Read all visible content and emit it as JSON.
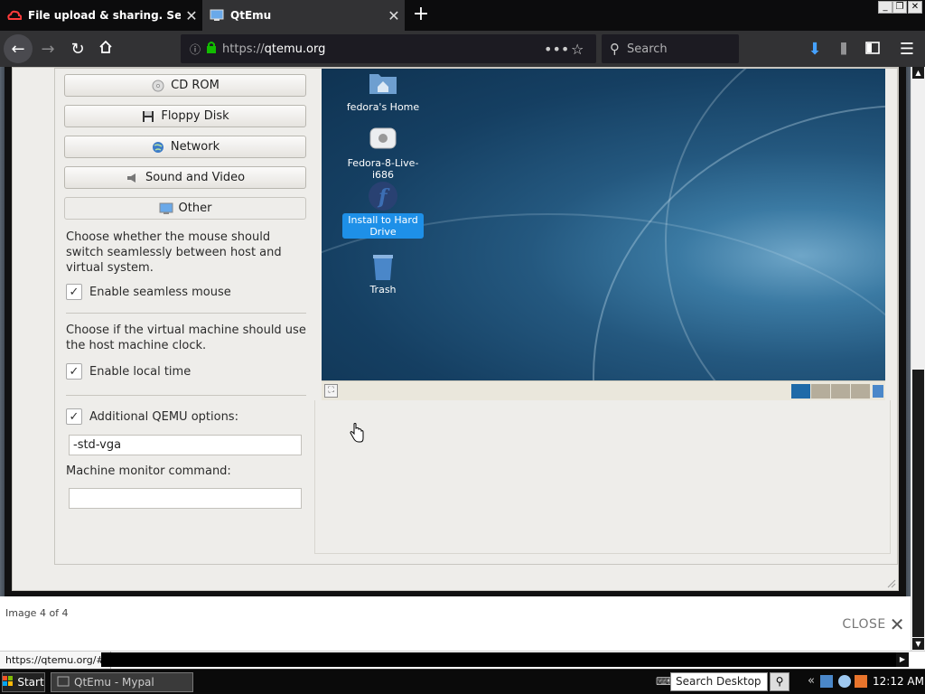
{
  "browser": {
    "tabs": [
      {
        "title": "File upload & sharing. Send lar",
        "icon": "cloud-icon",
        "active": false
      },
      {
        "title": "QtEmu",
        "icon": "qtemu-icon",
        "active": true
      }
    ],
    "url_prefix": "https://",
    "url_domain": "qtemu.org",
    "search_placeholder": "Search",
    "status_url": "https://qtemu.org/#"
  },
  "qtemu": {
    "categories": [
      {
        "label": "CD ROM",
        "icon": "cdrom-icon"
      },
      {
        "label": "Floppy Disk",
        "icon": "floppy-icon"
      },
      {
        "label": "Network",
        "icon": "network-icon"
      },
      {
        "label": "Sound and Video",
        "icon": "speaker-icon"
      },
      {
        "label": "Other",
        "icon": "monitor-icon"
      }
    ],
    "mouse_desc": "Choose whether the mouse should switch seamlessly between host and virtual system.",
    "seamless_mouse_label": "Enable seamless mouse",
    "seamless_mouse_checked": true,
    "clock_desc": "Choose if the virtual machine should use the host machine clock.",
    "local_time_label": "Enable local time",
    "local_time_checked": true,
    "additional_options_label": "Additional QEMU options:",
    "additional_options_checked": true,
    "additional_options_value": "-std-vga",
    "monitor_label": "Machine monitor command:",
    "monitor_value": ""
  },
  "vm_desktop": {
    "icons": [
      {
        "label": "fedora's Home",
        "icon": "home-folder-icon"
      },
      {
        "label": "Fedora-8-Live-i686",
        "icon": "disc-drive-icon"
      },
      {
        "label": "Install to Hard Drive",
        "icon": "fedora-logo-icon",
        "selected": true
      },
      {
        "label": "Trash",
        "icon": "trash-icon"
      }
    ]
  },
  "lightbox": {
    "counter": "Image 4 of 4",
    "close_label": "CLOSE"
  },
  "taskbar": {
    "start_label": "Start",
    "task_label": "QtEmu - Mypal",
    "search_placeholder": "Search Desktop",
    "clock": "12:12 AM"
  },
  "colors": {
    "tab_active": "#323234",
    "dialog_bg": "#eeedea",
    "selection": "#1e90e8",
    "vm_bg": "#153f62"
  }
}
